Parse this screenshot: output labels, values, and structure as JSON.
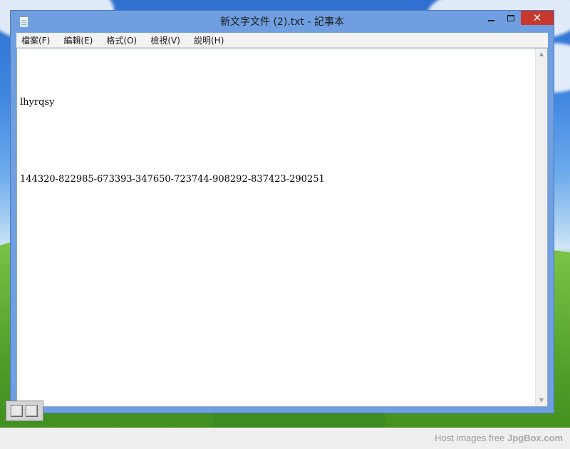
{
  "window": {
    "title": "新文字文件 (2).txt - 記事本",
    "close_label": "✕",
    "accent_color": "#6f9fe0",
    "close_color": "#c7382d",
    "icon": "notepad-icon"
  },
  "menubar": {
    "items": [
      {
        "label": "檔案(F)"
      },
      {
        "label": "編輯(E)"
      },
      {
        "label": "格式(O)"
      },
      {
        "label": "檢視(V)"
      },
      {
        "label": "說明(H)"
      }
    ]
  },
  "editor": {
    "lines": [
      "lhyrqsy",
      "",
      "144320-822985-673393-347650-723744-908292-837423-290251"
    ]
  },
  "scrollbar": {
    "up_arrow": "▲",
    "down_arrow": "▼"
  },
  "footer": {
    "prefix": "Host images free",
    "brand": "JpgBox.com"
  }
}
